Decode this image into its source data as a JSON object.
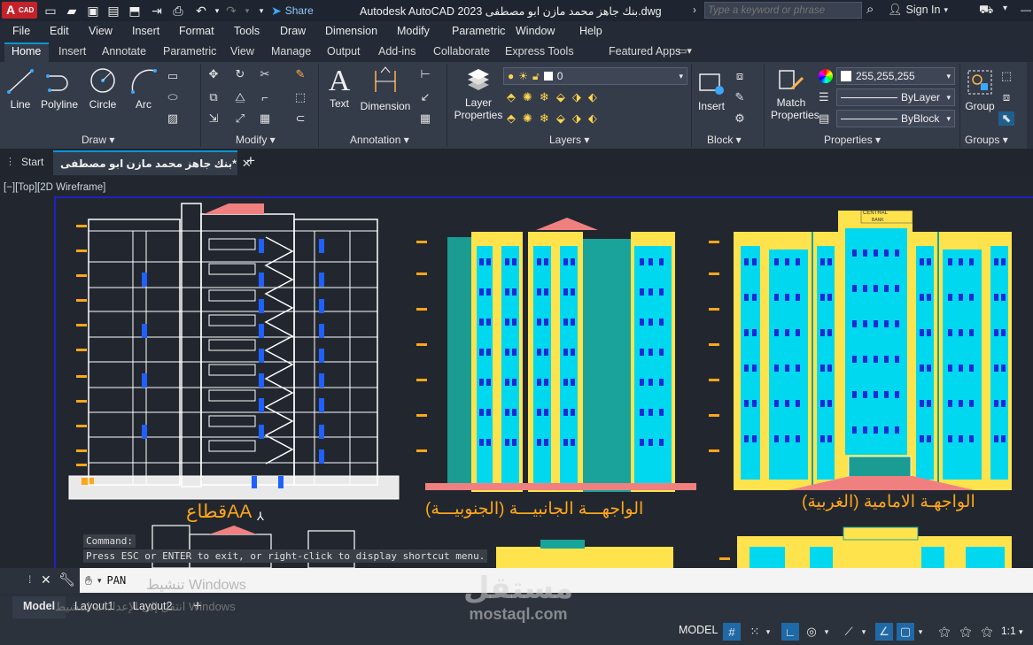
{
  "titlebar": {
    "app_badge": "A",
    "app_badge_sub": "CAD",
    "title": "Autodesk AutoCAD 2023   بنك جاهز محمد مازن ابو مصطفى.dwg",
    "share_label": "Share",
    "search_placeholder": "Type a keyword or phrase",
    "sign_in_label": "Sign In"
  },
  "menu": [
    "File",
    "Edit",
    "View",
    "Insert",
    "Format",
    "Tools",
    "Draw",
    "Dimension",
    "Modify",
    "Parametric",
    "Window",
    "Help"
  ],
  "ribbon_tabs": [
    "Home",
    "Insert",
    "Annotate",
    "Parametric",
    "View",
    "Manage",
    "Output",
    "Add-ins",
    "Collaborate",
    "Express Tools",
    "Featured Apps"
  ],
  "ribbon": {
    "draw": {
      "label": "Draw",
      "tools": [
        "Line",
        "Polyline",
        "Circle",
        "Arc"
      ]
    },
    "modify": {
      "label": "Modify"
    },
    "annotation": {
      "label": "Annotation",
      "tools": [
        "Text",
        "Dimension"
      ]
    },
    "layers": {
      "label": "Layers",
      "layer_properties_label_1": "Layer",
      "layer_properties_label_2": "Properties",
      "current_layer": "0"
    },
    "block": {
      "label": "Block",
      "insert_label": "Insert"
    },
    "properties": {
      "label": "Properties",
      "match_label_1": "Match",
      "match_label_2": "Properties",
      "color_value": "255,255,255",
      "linetype_value": "ByLayer",
      "lineweight_value": "ByBlock"
    },
    "groups": {
      "label": "Groups",
      "group_label": "Group"
    }
  },
  "doc_tabs": {
    "start_label": "Start",
    "active_label": "بنك جاهز محمد مازن ابو مصطفى*"
  },
  "viewport": {
    "label": "[−][Top][2D Wireframe]"
  },
  "drawing": {
    "section_title": "قطاعAA",
    "side_elevation_title": "الواجهـــة الجانبيـــة (الجنوبيـــة)",
    "front_elevation_title": "الواجهـة الامامية (الغربية)",
    "bank_sign": "CENTRAL",
    "bank_sign_sub": "BANK"
  },
  "command": {
    "history_label": "Command:",
    "history_message": "Press ESC or ENTER to exit, or right-click to display shortcut menu.",
    "current_command": "PAN",
    "activation_title": "تنشيط Windows",
    "activation_sub": "انتقل إلى الإعدادات لتنشيط Windows"
  },
  "layout_tabs": [
    "Model",
    "Layout1",
    "Layout2"
  ],
  "status": {
    "model_label": "MODEL",
    "scale_label": "1:1"
  },
  "watermark": {
    "brand": "مستقل",
    "site": "mostaql.com"
  },
  "colors": {
    "accent": "#0696d7",
    "drawing_yellow": "#ffe34d",
    "drawing_teal": "#1aa39a",
    "drawing_cyan": "#00f0ff",
    "drawing_orange": "#ffa61a"
  }
}
